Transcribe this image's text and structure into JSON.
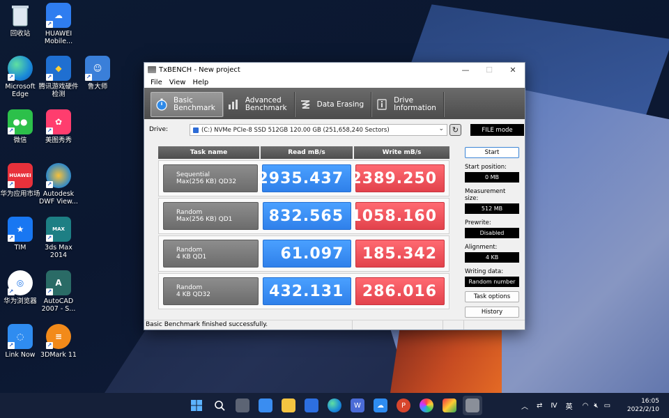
{
  "desktop": {
    "icons": [
      {
        "label": "回收站",
        "icon": "recycle-bin-icon"
      },
      {
        "label": "HUAWEI Mobile...",
        "icon": "cloud-icon"
      },
      {
        "label": "Microsoft Edge",
        "icon": "edge-icon"
      },
      {
        "label": "腾讯游戏硬件检测",
        "icon": "hardware-check-icon"
      },
      {
        "label": "鲁大师",
        "icon": "ludashi-icon"
      },
      {
        "label": "微信",
        "icon": "wechat-icon"
      },
      {
        "label": "美图秀秀",
        "icon": "meitu-icon"
      },
      {
        "label": "华为应用市场",
        "icon": "huawei-appgallery-icon"
      },
      {
        "label": "Autodesk DWF View...",
        "icon": "autodesk-icon"
      },
      {
        "label": "TIM",
        "icon": "tim-icon"
      },
      {
        "label": "3ds Max 2014",
        "icon": "3dsmax-icon"
      },
      {
        "label": "华为浏览器",
        "icon": "huawei-browser-icon"
      },
      {
        "label": "AutoCAD 2007 - S...",
        "icon": "autocad-icon"
      },
      {
        "label": "Link Now",
        "icon": "link-now-icon"
      },
      {
        "label": "3DMark 11",
        "icon": "3dmark-icon"
      }
    ]
  },
  "window": {
    "title": "TxBENCH - New project",
    "menu": [
      "File",
      "View",
      "Help"
    ],
    "tabs": [
      {
        "line1": "Basic",
        "line2": "Benchmark",
        "icon": "stopwatch-icon"
      },
      {
        "line1": "Advanced",
        "line2": "Benchmark",
        "icon": "bar-chart-icon"
      },
      {
        "line1": "Data Erasing",
        "line2": "",
        "icon": "eraser-icon"
      },
      {
        "line1": "Drive",
        "line2": "Information",
        "icon": "info-icon"
      }
    ],
    "drive_label": "Drive:",
    "drive_value": "(C:) NVMe PCIe-8 SSD 512GB   120.00 GB (251,658,240 Sectors)",
    "file_mode": "FILE mode",
    "table": {
      "headers": [
        "Task name",
        "Read mB/s",
        "Write mB/s"
      ],
      "rows": [
        {
          "task1": "Sequential",
          "task2": "Max(256 KB) QD32",
          "read": "2935.437",
          "write": "2389.250"
        },
        {
          "task1": "Random",
          "task2": "Max(256 KB) QD1",
          "read": "832.565",
          "write": "1058.160"
        },
        {
          "task1": "Random",
          "task2": "4 KB QD1",
          "read": "61.097",
          "write": "185.342"
        },
        {
          "task1": "Random",
          "task2": "4 KB QD32",
          "read": "432.131",
          "write": "286.016"
        }
      ]
    },
    "side": {
      "start": "Start",
      "start_position_label": "Start position:",
      "start_position": "0 MB",
      "measurement_size_label": "Measurement size:",
      "measurement_size": "512 MB",
      "prewrite_label": "Prewrite:",
      "prewrite": "Disabled",
      "alignment_label": "Alignment:",
      "alignment": "4 KB",
      "writing_data_label": "Writing data:",
      "writing_data": "Random number",
      "task_options": "Task options",
      "history": "History"
    },
    "status": "Basic Benchmark finished successfully."
  },
  "taskbar": {
    "ime": "英",
    "time": "16:05",
    "date": "2022/2/10"
  }
}
